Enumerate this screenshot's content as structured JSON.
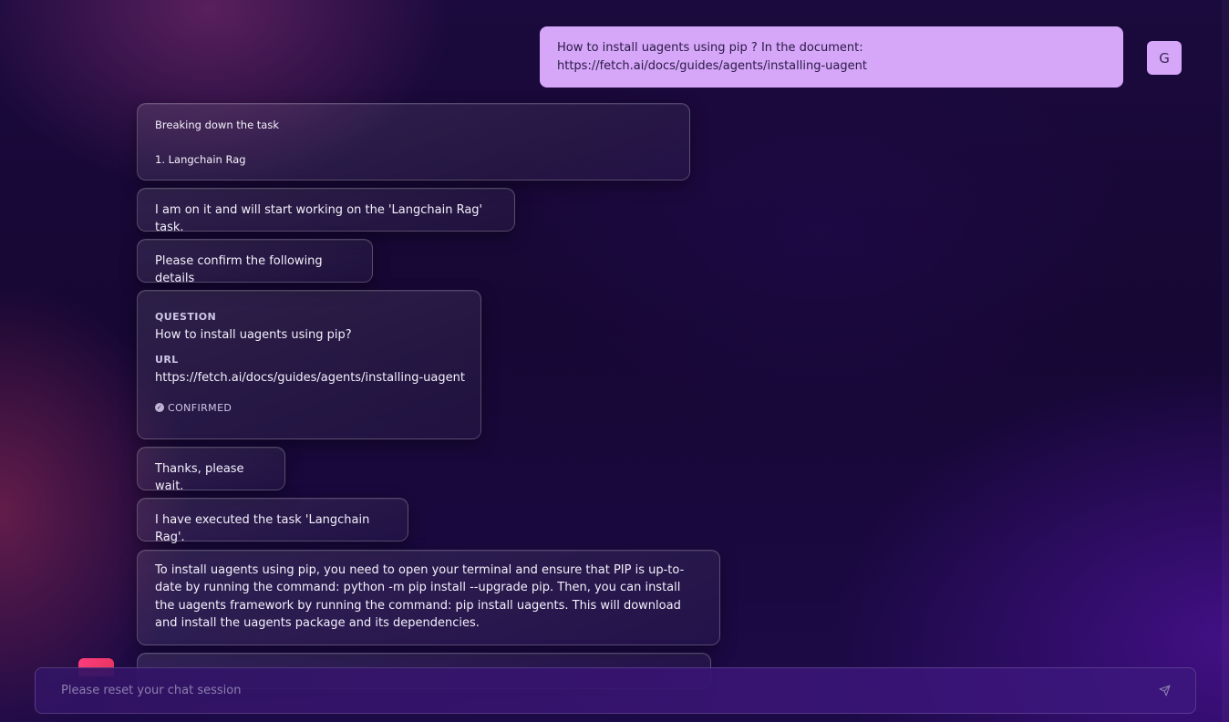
{
  "user": {
    "avatar_initial": "G",
    "message_lines": [
      "How to install uagents using pip ? In the document:",
      "https://fetch.ai/docs/guides/agents/installing-uagent"
    ]
  },
  "agent_messages": {
    "breakdown_title": "Breaking down the task",
    "breakdown_item": "1. Langchain Rag",
    "working": "I am on it and will start working on the 'Langchain Rag' task.",
    "confirm_prompt": "Please confirm the following details",
    "details": {
      "question_label": "QUESTION",
      "question_value": "How to install uagents using pip?",
      "url_label": "URL",
      "url_value": "https://fetch.ai/docs/guides/agents/installing-uagent",
      "status": "CONFIRMED"
    },
    "wait": "Thanks, please wait.",
    "executed": "I have executed the task 'Langchain Rag'.",
    "answer": "To install uagents using pip, you need to open your terminal and ensure that PIP is up-to-date by running the command: python -m pip install --upgrade pip. Then, you can install the uagents framework by running the command: pip install uagents. This will download and install the uagents package and its dependencies."
  },
  "input": {
    "placeholder": "Please reset your chat session",
    "value": ""
  },
  "icons": {
    "send": "send-icon",
    "check": "check-circle-icon"
  },
  "colors": {
    "user_bubble": "#d6a6f9",
    "agent_avatar": "#ff3d7f"
  }
}
